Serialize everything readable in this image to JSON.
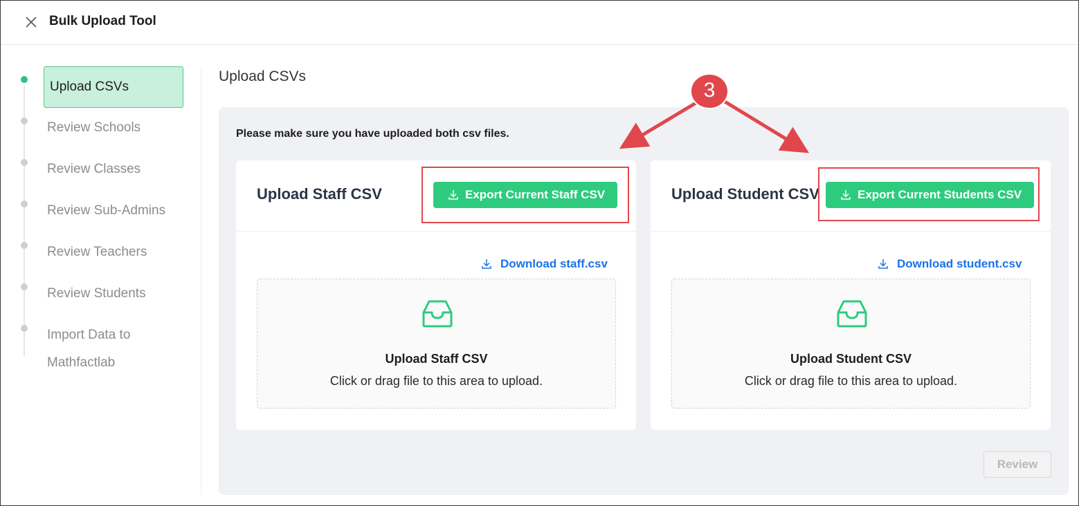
{
  "header": {
    "title": "Bulk Upload Tool"
  },
  "stepper": {
    "steps": [
      {
        "label": "Upload CSVs",
        "active": true
      },
      {
        "label": "Review Schools"
      },
      {
        "label": "Review Classes"
      },
      {
        "label": "Review Sub-Admins"
      },
      {
        "label": "Review Teachers"
      },
      {
        "label": "Review Students"
      },
      {
        "label": "Import Data to"
      },
      {
        "label": "Mathfactlab"
      }
    ]
  },
  "main": {
    "title": "Upload CSVs",
    "notice": "Please make sure you have uploaded both csv files.",
    "staff": {
      "title": "Upload Staff CSV",
      "export_label": "Export Current Staff CSV",
      "download_label": "Download staff.csv",
      "dropzone_title": "Upload Staff CSV",
      "dropzone_hint": "Click or drag file to this area to upload."
    },
    "student": {
      "title": "Upload Student CSV",
      "export_label": "Export Current Students CSV",
      "download_label": "Download student.csv",
      "dropzone_title": "Upload Student CSV",
      "dropzone_hint": "Click or drag file to this area to upload."
    },
    "review_label": "Review"
  },
  "annotation": {
    "number": "3"
  },
  "colors": {
    "accent": "#2ecb7f",
    "link": "#1a73e8",
    "annotation": "#e0474c",
    "active_step_bg": "#c9f0dc"
  }
}
